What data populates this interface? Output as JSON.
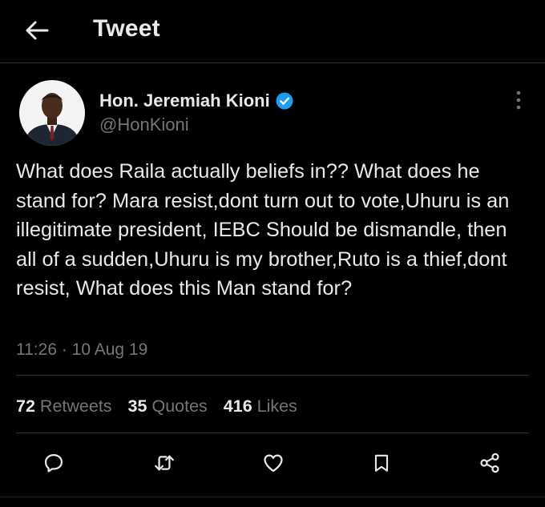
{
  "header": {
    "title": "Tweet",
    "back_icon": "arrow-left-icon"
  },
  "tweet": {
    "author": {
      "name": "Hon. Jeremiah Kioni",
      "handle": "@HonKioni",
      "verified": true,
      "verified_color": "#1d9bf0"
    },
    "text": "What does Raila actually beliefs in?? What does he stand for? Mara resist,dont turn out to vote,Uhuru is an illegitimate president, IEBC Should be dismandle, then all of a sudden,Uhuru is my brother,Ruto is a thief,dont resist, What does this Man stand for?",
    "timestamp": "11:26 · 10 Aug 19",
    "stats": {
      "retweets": {
        "count": "72",
        "label": "Retweets"
      },
      "quotes": {
        "count": "35",
        "label": "Quotes"
      },
      "likes": {
        "count": "416",
        "label": "Likes"
      }
    }
  },
  "actions": [
    {
      "name": "reply",
      "icon": "reply-icon"
    },
    {
      "name": "retweet",
      "icon": "retweet-icon"
    },
    {
      "name": "like",
      "icon": "heart-icon"
    },
    {
      "name": "bookmark",
      "icon": "bookmark-icon"
    },
    {
      "name": "share",
      "icon": "share-icon"
    }
  ],
  "colors": {
    "background": "#000000",
    "text_primary": "#e7e9ea",
    "text_secondary": "#71767b",
    "divider": "#2f3336",
    "accent": "#1d9bf0"
  }
}
